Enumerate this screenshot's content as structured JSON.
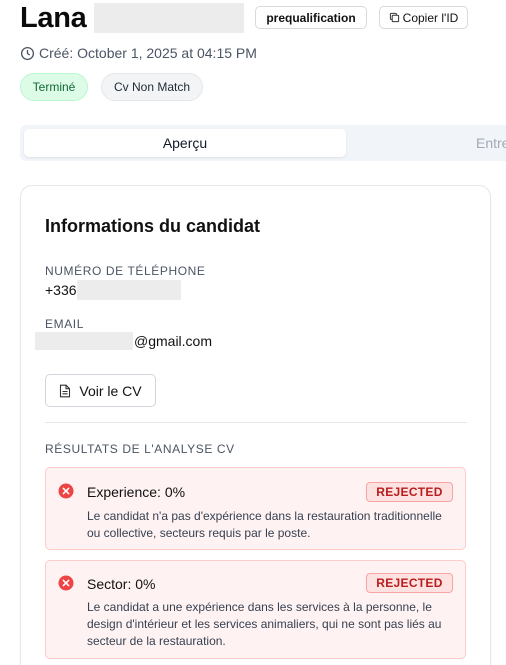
{
  "header": {
    "name": "Lana",
    "prequal_label": "prequalification",
    "copy_label": "Copier l'ID"
  },
  "created": "Créé: October 1, 2025 at 04:15 PM",
  "badges": {
    "status": "Terminé",
    "match": "Cv Non Match"
  },
  "tabs": {
    "active": "Aperçu",
    "next": "Entre"
  },
  "candidate": {
    "title": "Informations du candidat",
    "phone_label": "Numéro de téléphone",
    "phone_prefix": "+336",
    "email_label": "Email",
    "email_suffix": "@gmail.com",
    "cv_button": "Voir le CV"
  },
  "analysis": {
    "section_label": "Résultats de l'analyse CV",
    "results": [
      {
        "title": "Experience: 0%",
        "tag": "REJECTED",
        "text": "Le candidat n'a pas d'expérience dans la restauration traditionnelle ou collective, secteurs requis par le poste."
      },
      {
        "title": "Sector: 0%",
        "tag": "REJECTED",
        "text": "Le candidat a une expérience dans les services à la personne, le design d'intérieur et les services animaliers, qui ne sont pas liés au secteur de la restauration."
      }
    ]
  },
  "colors": {
    "success_bg": "#dcfce7",
    "success_text": "#166534",
    "danger_bg": "#fef2f2",
    "danger_border": "#fecaca",
    "danger_text": "#b91c1c",
    "danger_icon": "#ef4444"
  },
  "icons": {
    "created": "clock-icon",
    "copy": "copy-icon",
    "cv": "file-icon",
    "rejected": "x-circle-icon"
  }
}
